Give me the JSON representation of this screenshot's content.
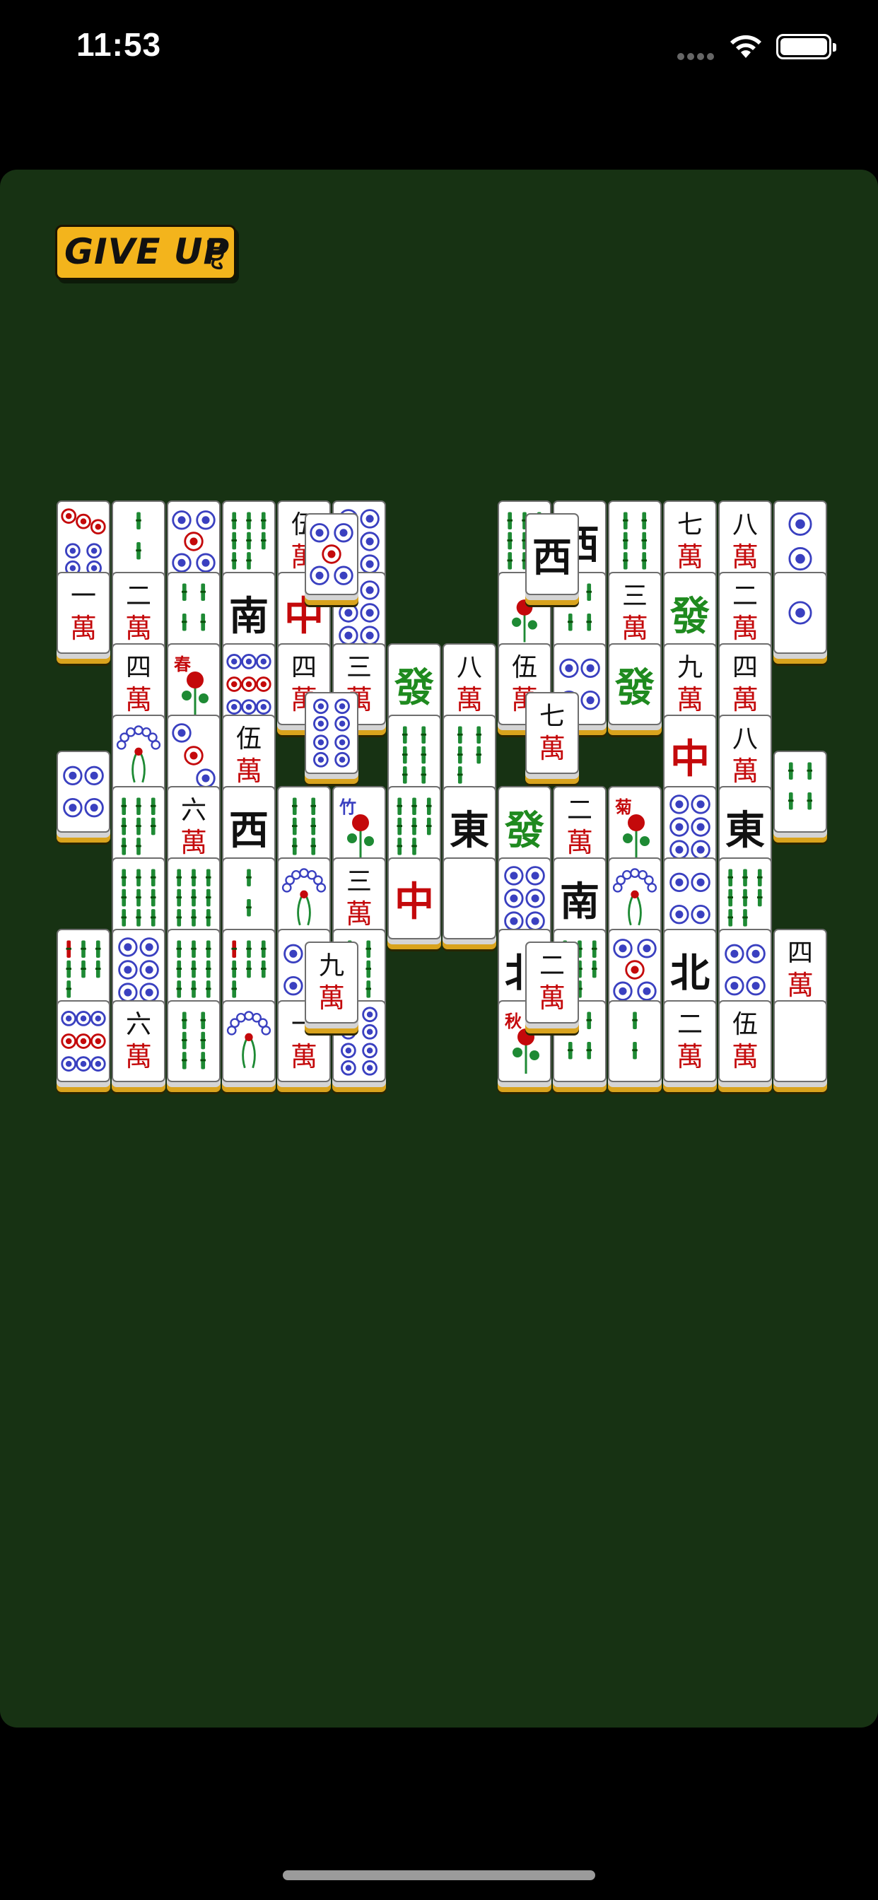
{
  "status_bar": {
    "time": "11:53",
    "wifi_icon": "wifi-icon",
    "battery_icon": "battery-full-icon"
  },
  "game": {
    "give_up_label": "GIVE UP",
    "give_up_icon": "cat-icon",
    "colors": {
      "board": "#173213",
      "button": "#f3b41c",
      "tile_edge_gold": "#d9a31d",
      "red_char": "#c4090b",
      "green_char": "#1f8a1f",
      "blue_dot": "#3a40c0"
    }
  },
  "tiles": [
    {
      "col": 0,
      "row": 0,
      "k": "d7"
    },
    {
      "col": 1,
      "row": 0,
      "k": "b2"
    },
    {
      "col": 2,
      "row": 0,
      "k": "d5"
    },
    {
      "col": 3,
      "row": 0,
      "k": "b8"
    },
    {
      "col": 4,
      "row": 0,
      "k": "c",
      "t": "伍"
    },
    {
      "col": 5,
      "row": 0,
      "k": "d6"
    },
    {
      "col": 8,
      "row": 0,
      "k": "b9"
    },
    {
      "col": 9,
      "row": 0,
      "k": "w",
      "t": "西"
    },
    {
      "col": 10,
      "row": 0,
      "k": "b6"
    },
    {
      "col": 11,
      "row": 0,
      "k": "c",
      "t": "七"
    },
    {
      "col": 12,
      "row": 0,
      "k": "c",
      "t": "八"
    },
    {
      "col": 13,
      "row": 0,
      "k": "d2"
    },
    {
      "col": 0,
      "row": 1,
      "k": "c",
      "t": "一"
    },
    {
      "col": 1,
      "row": 1,
      "k": "c",
      "t": "二"
    },
    {
      "col": 2,
      "row": 1,
      "k": "b4"
    },
    {
      "col": 3,
      "row": 1,
      "k": "w",
      "t": "南"
    },
    {
      "col": 4,
      "row": 1,
      "k": "r",
      "t": "中"
    },
    {
      "col": 5,
      "row": 1,
      "k": "d6"
    },
    {
      "col": 8,
      "row": 1,
      "k": "flower"
    },
    {
      "col": 9,
      "row": 1,
      "k": "b4"
    },
    {
      "col": 10,
      "row": 1,
      "k": "c",
      "t": "三"
    },
    {
      "col": 11,
      "row": 1,
      "k": "g",
      "t": "發"
    },
    {
      "col": 12,
      "row": 1,
      "k": "c",
      "t": "二"
    },
    {
      "col": 13,
      "row": 1,
      "k": "d1"
    },
    {
      "col": 1,
      "row": 2,
      "k": "c",
      "t": "四"
    },
    {
      "col": 2,
      "row": 2,
      "k": "season",
      "t": "春"
    },
    {
      "col": 3,
      "row": 2,
      "k": "d9"
    },
    {
      "col": 4,
      "row": 2,
      "k": "c",
      "t": "四"
    },
    {
      "col": 5,
      "row": 2,
      "k": "c",
      "t": "三"
    },
    {
      "col": 6,
      "row": 2,
      "k": "g",
      "t": "發"
    },
    {
      "col": 7,
      "row": 2,
      "k": "c",
      "t": "八"
    },
    {
      "col": 8,
      "row": 2,
      "k": "c",
      "t": "伍"
    },
    {
      "col": 9,
      "row": 2,
      "k": "d4"
    },
    {
      "col": 10,
      "row": 2,
      "k": "g",
      "t": "發"
    },
    {
      "col": 11,
      "row": 2,
      "k": "c",
      "t": "九"
    },
    {
      "col": 12,
      "row": 2,
      "k": "c",
      "t": "四"
    },
    {
      "col": 1,
      "row": 3,
      "k": "b1"
    },
    {
      "col": 2,
      "row": 3,
      "k": "d3"
    },
    {
      "col": 3,
      "row": 3,
      "k": "c",
      "t": "伍"
    },
    {
      "col": 6,
      "row": 3,
      "k": "b6"
    },
    {
      "col": 7,
      "row": 3,
      "k": "b5"
    },
    {
      "col": 11,
      "row": 3,
      "k": "r",
      "t": "中"
    },
    {
      "col": 12,
      "row": 3,
      "k": "c",
      "t": "八"
    },
    {
      "col": 0,
      "row": 3.5,
      "k": "d4"
    },
    {
      "col": 13,
      "row": 3.5,
      "k": "b4"
    },
    {
      "col": 1,
      "row": 4,
      "k": "b8"
    },
    {
      "col": 2,
      "row": 4,
      "k": "c",
      "t": "六"
    },
    {
      "col": 3,
      "row": 4,
      "k": "w",
      "t": "西"
    },
    {
      "col": 4,
      "row": 4,
      "k": "b6"
    },
    {
      "col": 5,
      "row": 4,
      "k": "bamboo",
      "t": "竹"
    },
    {
      "col": 6,
      "row": 4,
      "k": "b8"
    },
    {
      "col": 7,
      "row": 4,
      "k": "w",
      "t": "東"
    },
    {
      "col": 8,
      "row": 4,
      "k": "g",
      "t": "發"
    },
    {
      "col": 9,
      "row": 4,
      "k": "c",
      "t": "二"
    },
    {
      "col": 10,
      "row": 4,
      "k": "flower2",
      "t": "菊"
    },
    {
      "col": 11,
      "row": 4,
      "k": "d6"
    },
    {
      "col": 12,
      "row": 4,
      "k": "w",
      "t": "東"
    },
    {
      "col": 1,
      "row": 5,
      "k": "b9"
    },
    {
      "col": 2,
      "row": 5,
      "k": "b9"
    },
    {
      "col": 3,
      "row": 5,
      "k": "b2"
    },
    {
      "col": 4,
      "row": 5,
      "k": "b1"
    },
    {
      "col": 5,
      "row": 5,
      "k": "c",
      "t": "三"
    },
    {
      "col": 6,
      "row": 5,
      "k": "r",
      "t": "中"
    },
    {
      "col": 7,
      "row": 5,
      "k": "blank"
    },
    {
      "col": 8,
      "row": 5,
      "k": "d6"
    },
    {
      "col": 9,
      "row": 5,
      "k": "w",
      "t": "南"
    },
    {
      "col": 10,
      "row": 5,
      "k": "b1"
    },
    {
      "col": 11,
      "row": 5,
      "k": "d4"
    },
    {
      "col": 12,
      "row": 5,
      "k": "b8"
    },
    {
      "col": 0,
      "row": 6,
      "k": "b7"
    },
    {
      "col": 1,
      "row": 6,
      "k": "d6"
    },
    {
      "col": 2,
      "row": 6,
      "k": "b9"
    },
    {
      "col": 3,
      "row": 6,
      "k": "b7"
    },
    {
      "col": 4,
      "row": 6,
      "k": "d4"
    },
    {
      "col": 5,
      "row": 6,
      "k": "b6"
    },
    {
      "col": 8,
      "row": 6,
      "k": "w",
      "t": "北"
    },
    {
      "col": 9,
      "row": 6,
      "k": "b8"
    },
    {
      "col": 10,
      "row": 6,
      "k": "d5"
    },
    {
      "col": 11,
      "row": 6,
      "k": "w",
      "t": "北"
    },
    {
      "col": 12,
      "row": 6,
      "k": "d4"
    },
    {
      "col": 13,
      "row": 6,
      "k": "c",
      "t": "四"
    },
    {
      "col": 0,
      "row": 7,
      "k": "d9"
    },
    {
      "col": 1,
      "row": 7,
      "k": "c",
      "t": "六"
    },
    {
      "col": 2,
      "row": 7,
      "k": "b6"
    },
    {
      "col": 3,
      "row": 7,
      "k": "b1"
    },
    {
      "col": 4,
      "row": 7,
      "k": "c",
      "t": "一"
    },
    {
      "col": 5,
      "row": 7,
      "k": "d8"
    },
    {
      "col": 8,
      "row": 7,
      "k": "season",
      "t": "秋"
    },
    {
      "col": 9,
      "row": 7,
      "k": "b4"
    },
    {
      "col": 10,
      "row": 7,
      "k": "b2"
    },
    {
      "col": 11,
      "row": 7,
      "k": "c",
      "t": "二"
    },
    {
      "col": 12,
      "row": 7,
      "k": "c",
      "t": "伍"
    },
    {
      "col": 13,
      "row": 7,
      "k": "blank"
    },
    {
      "col": 4.5,
      "row": 2.8,
      "k": "d8",
      "top": 1
    },
    {
      "col": 4.5,
      "row": 0.3,
      "k": "d5",
      "top": 1
    },
    {
      "col": 8.5,
      "row": 0.3,
      "k": "w",
      "t": "西",
      "top": 1
    },
    {
      "col": 8.5,
      "row": 2.8,
      "k": "c",
      "t": "七",
      "top": 1
    },
    {
      "col": 4.5,
      "row": 6.3,
      "k": "c",
      "t": "九",
      "top": 1
    },
    {
      "col": 8.5,
      "row": 6.3,
      "k": "c",
      "t": "二",
      "top": 1
    }
  ]
}
